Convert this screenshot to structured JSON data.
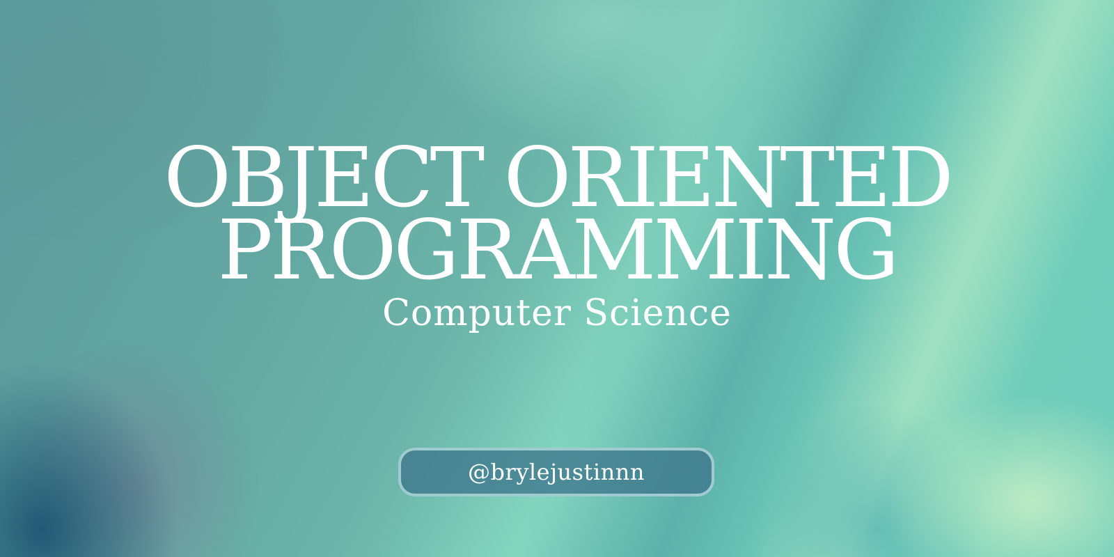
{
  "banner": {
    "title_line1": "OBJECT ORIENTED",
    "title_line2": "PROGRAMMING",
    "subtitle": "Computer Science",
    "handle": "@brylejustinnn"
  },
  "colors": {
    "text": "#ffffff",
    "background_teal": "#62a6a0",
    "background_mint": "#85d8c0",
    "background_light_green": "#d7f5c8",
    "background_deep_blue": "#1e5573",
    "pill_fill": "#3e768c",
    "pill_border": "#afd7dc"
  }
}
